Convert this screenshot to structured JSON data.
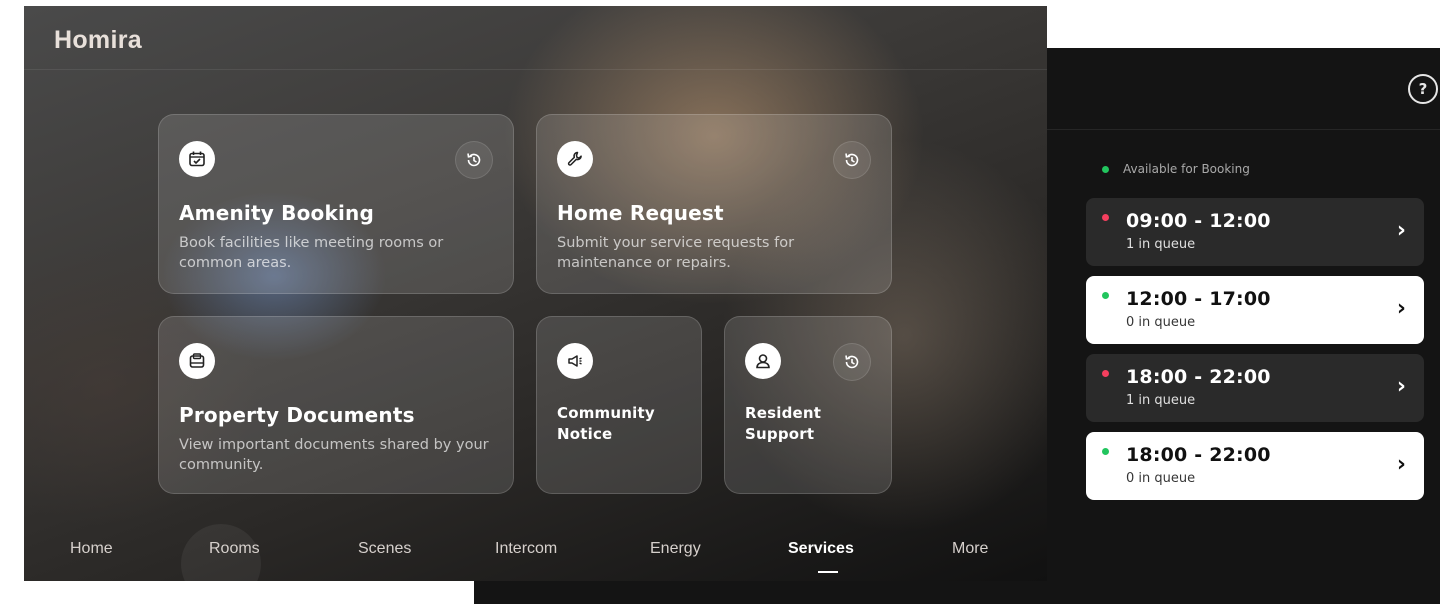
{
  "app": {
    "logo": "Homira"
  },
  "cards": {
    "amenity": {
      "title": "Amenity Booking",
      "desc": "Book facilities like meeting rooms or common areas.",
      "icon": "calendar-check-icon"
    },
    "home_request": {
      "title": "Home Request",
      "desc": "Submit your service requests for maintenance or repairs.",
      "icon": "wrench-icon"
    },
    "documents": {
      "title": "Property Documents",
      "desc": "View important documents shared by your community.",
      "icon": "archive-box-icon"
    },
    "notice": {
      "title": "Community Notice",
      "icon": "megaphone-icon"
    },
    "support": {
      "title": "Resident Support",
      "icon": "person-icon"
    }
  },
  "nav": {
    "items": [
      "Home",
      "Rooms",
      "Scenes",
      "Intercom",
      "Energy",
      "Services",
      "More"
    ],
    "active": "Services"
  },
  "booking": {
    "legend": "Available for Booking",
    "slots": [
      {
        "time": "09:00 - 12:00",
        "queue": "1 in queue",
        "status": "unavailable"
      },
      {
        "time": "12:00 - 17:00",
        "queue": "0 in queue",
        "status": "available"
      },
      {
        "time": "18:00 - 22:00",
        "queue": "1 in queue",
        "status": "unavailable"
      },
      {
        "time": "18:00 - 22:00",
        "queue": "0 in queue",
        "status": "available"
      }
    ]
  },
  "colors": {
    "available": "#22c55e",
    "unavailable": "#f43f5e",
    "background_dark": "#141414"
  }
}
